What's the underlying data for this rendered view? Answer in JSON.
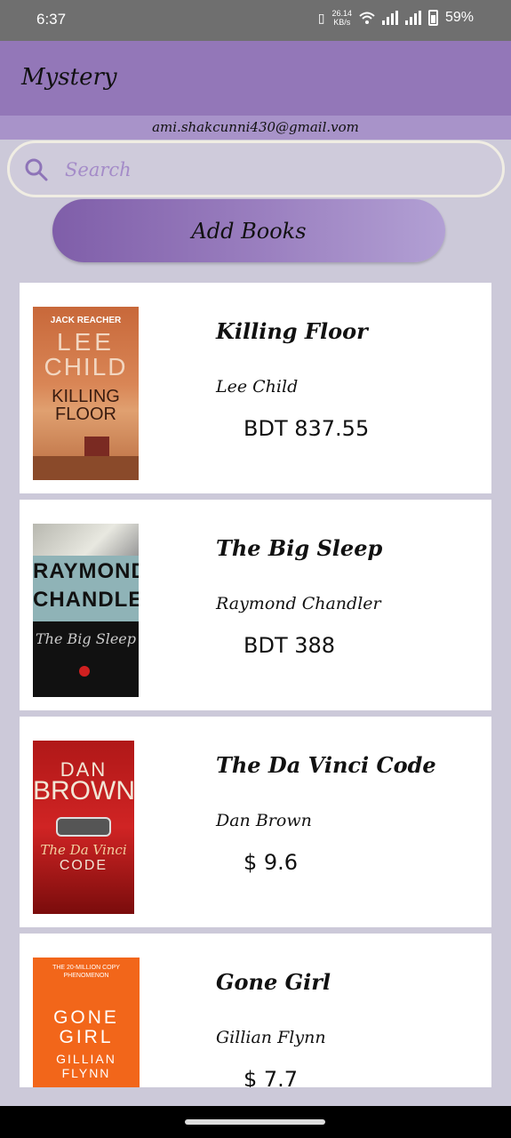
{
  "status": {
    "time": "6:37",
    "net_speed_top": "26.14",
    "net_speed_unit": "KB/s",
    "battery": "59%"
  },
  "appbar": {
    "title": "Mystery"
  },
  "account": {
    "email": "ami.shakcunni430@gmail.vom"
  },
  "search": {
    "placeholder": "Search"
  },
  "add_button": {
    "label": "Add Books"
  },
  "books": [
    {
      "title": "Killing Floor",
      "author": "Lee Child",
      "price": "BDT 837.55",
      "cover": {
        "line1": "JACK REACHER",
        "line2": "LEE",
        "line3": "CHILD",
        "line4": "KILLING",
        "line5": "FLOOR"
      }
    },
    {
      "title": "The Big Sleep",
      "author": "Raymond Chandler",
      "price": "BDT 388",
      "cover": {
        "line1": "RAYMOND",
        "line2": "CHANDLER",
        "line3": "The Big Sleep"
      }
    },
    {
      "title": "The Da Vinci Code",
      "author": "Dan Brown",
      "price": "$ 9.6",
      "cover": {
        "line1": "DAN",
        "line2": "BROWN",
        "line3": "The Da Vinci",
        "line4": "CODE"
      }
    },
    {
      "title": "Gone Girl",
      "author": "Gillian Flynn",
      "price": "$ 7.7",
      "cover": {
        "line1": "THE 20-MILLION COPY",
        "line2": "PHENOMENON",
        "line3": "GONE",
        "line4": "GIRL",
        "line5": "GILLIAN",
        "line6": "FLYNN"
      }
    }
  ],
  "colors": {
    "appbar": "#9377b8",
    "background": "#ccc9d9",
    "accent": "#8e74b8"
  }
}
